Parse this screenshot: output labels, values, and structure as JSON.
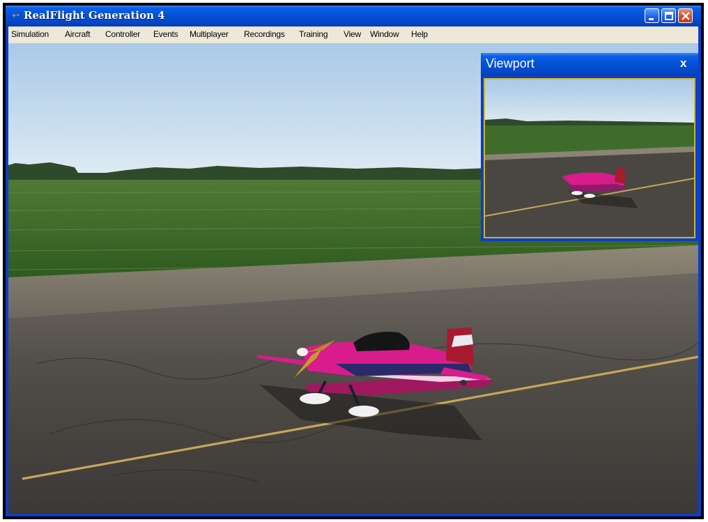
{
  "window": {
    "title": "RealFlight Generation 4",
    "app_icon": "aircraft-icon"
  },
  "menu": {
    "items": [
      "Simulation",
      "Aircraft",
      "Controller",
      "Events",
      "Multiplayer",
      "Recordings",
      "Training",
      "View",
      "Window",
      "Help"
    ]
  },
  "viewport_panel": {
    "title": "Viewport",
    "close_label": "x"
  },
  "colors": {
    "title_blue": "#0552d6",
    "menu_bg": "#ece9d8",
    "viewport_border": "#c9b630",
    "close_red": "#e0471e"
  }
}
